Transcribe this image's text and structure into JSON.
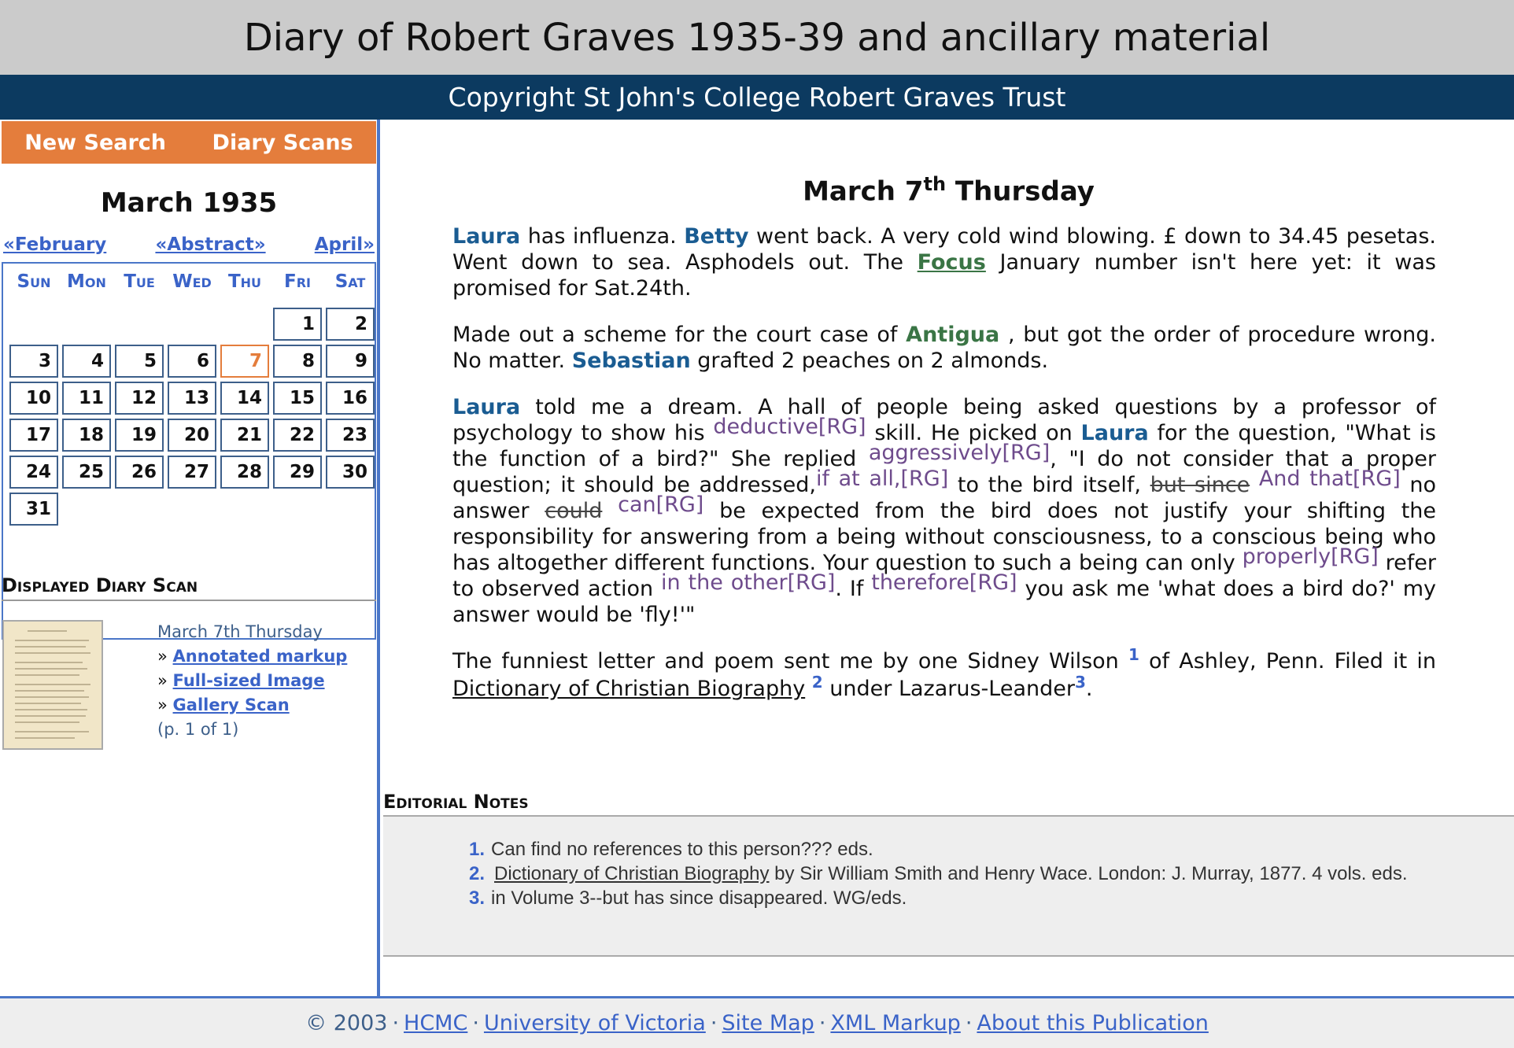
{
  "header": {
    "title": "Diary of Robert Graves 1935-39 and ancillary material",
    "subtitle": "Copyright St John's College Robert Graves Trust"
  },
  "nav": {
    "new_search": "New Search",
    "diary_scans": "Diary Scans"
  },
  "calendar": {
    "month_title": "March 1935",
    "prev_link": "«February",
    "abstract_link": "«Abstract»",
    "next_link": "April»",
    "weekdays": [
      "Sun",
      "Mon",
      "Tue",
      "Wed",
      "Thu",
      "Fri",
      "Sat"
    ],
    "days": [
      "1",
      "2",
      "3",
      "4",
      "5",
      "6",
      "7",
      "8",
      "9",
      "10",
      "11",
      "12",
      "13",
      "14",
      "15",
      "16",
      "17",
      "18",
      "19",
      "20",
      "21",
      "22",
      "23",
      "24",
      "25",
      "26",
      "27",
      "28",
      "29",
      "30",
      "31"
    ],
    "selected_day": "7"
  },
  "scan": {
    "heading": "Displayed Diary Scan",
    "caption": "March 7th Thursday",
    "links": [
      "Annotated markup",
      "Full-sized Image",
      "Gallery Scan"
    ],
    "arrow": "»",
    "page_info": "(p. 1 of 1)"
  },
  "entry": {
    "title_main": "March 7",
    "title_sup": "th",
    "title_rest": " Thursday",
    "p1": {
      "laura": "Laura",
      "t1": " has influenza. ",
      "betty": "Betty",
      "t2": " went back. A very cold wind blowing. £ down to 34.45 pesetas. Went down to sea. Asphodels out. The ",
      "focus": "Focus",
      "t3": " January number isn't here yet: it was promised for Sat.24th."
    },
    "p2": {
      "t1": "Made out a scheme for the court case of ",
      "antigua": "Antigua",
      "t2": " , but got the order of procedure wrong. No matter. ",
      "sebastian": "Sebastian",
      "t3": " grafted 2 peaches on 2 almonds."
    },
    "p3": {
      "laura": "Laura",
      "t1": " told me a dream. A hall of people being asked questions by a professor of psychology to show his ",
      "add1": "deductive[RG]",
      "t2": " skill. He picked on ",
      "laura2": "Laura",
      "t3": " for the question, \"What is the function of a bird?\" She replied ",
      "add2": "aggressively[RG]",
      "t4": ", \"I do not consider that a proper question; it should be addressed,",
      "add3": "if at all,[RG]",
      "t5": " to the bird itself, ",
      "del1": "but since",
      "add4": " And that[RG]",
      "t6": " no answer ",
      "del2": "could",
      "add5": " can[RG]",
      "t7": " be expected from the bird does not justify your shifting the responsibility for answering from a being without consciousness, to a conscious being who has altogether different functions. Your question to such a being can only ",
      "add6": "properly[RG]",
      "t8": " refer to observed action ",
      "add7": "in the other[RG]",
      "t9": ". If ",
      "add8": "therefore[RG]",
      "t10": " you ask me 'what does a bird do?' my answer would be 'fly!'\""
    },
    "p4": {
      "t1": "The funniest letter and poem sent me by one Sidney Wilson ",
      "fn1": "1",
      "t2": " of Ashley, Penn. Filed it in ",
      "dict": "Dictionary of Christian Biography",
      "fn2": "2",
      "t3": " under Lazarus-Leander",
      "fn3": "3",
      "t4": "."
    }
  },
  "notes": {
    "heading": "Editorial Notes",
    "items": [
      {
        "num": "1.",
        "text": "Can find no references to this person??? eds."
      },
      {
        "num": "2.",
        "title": "Dictionary of Christian Biography",
        "text": " by Sir William Smith and Henry Wace. London: J. Murray, 1877. 4 vols. eds."
      },
      {
        "num": "3.",
        "text": "in Volume 3--but has since disappeared. WG/eds."
      }
    ]
  },
  "footer": {
    "copyright": "© 2003",
    "links": [
      "HCMC",
      "University of Victoria",
      "Site Map",
      "XML Markup",
      "About this Publication"
    ],
    "sep": "·"
  }
}
